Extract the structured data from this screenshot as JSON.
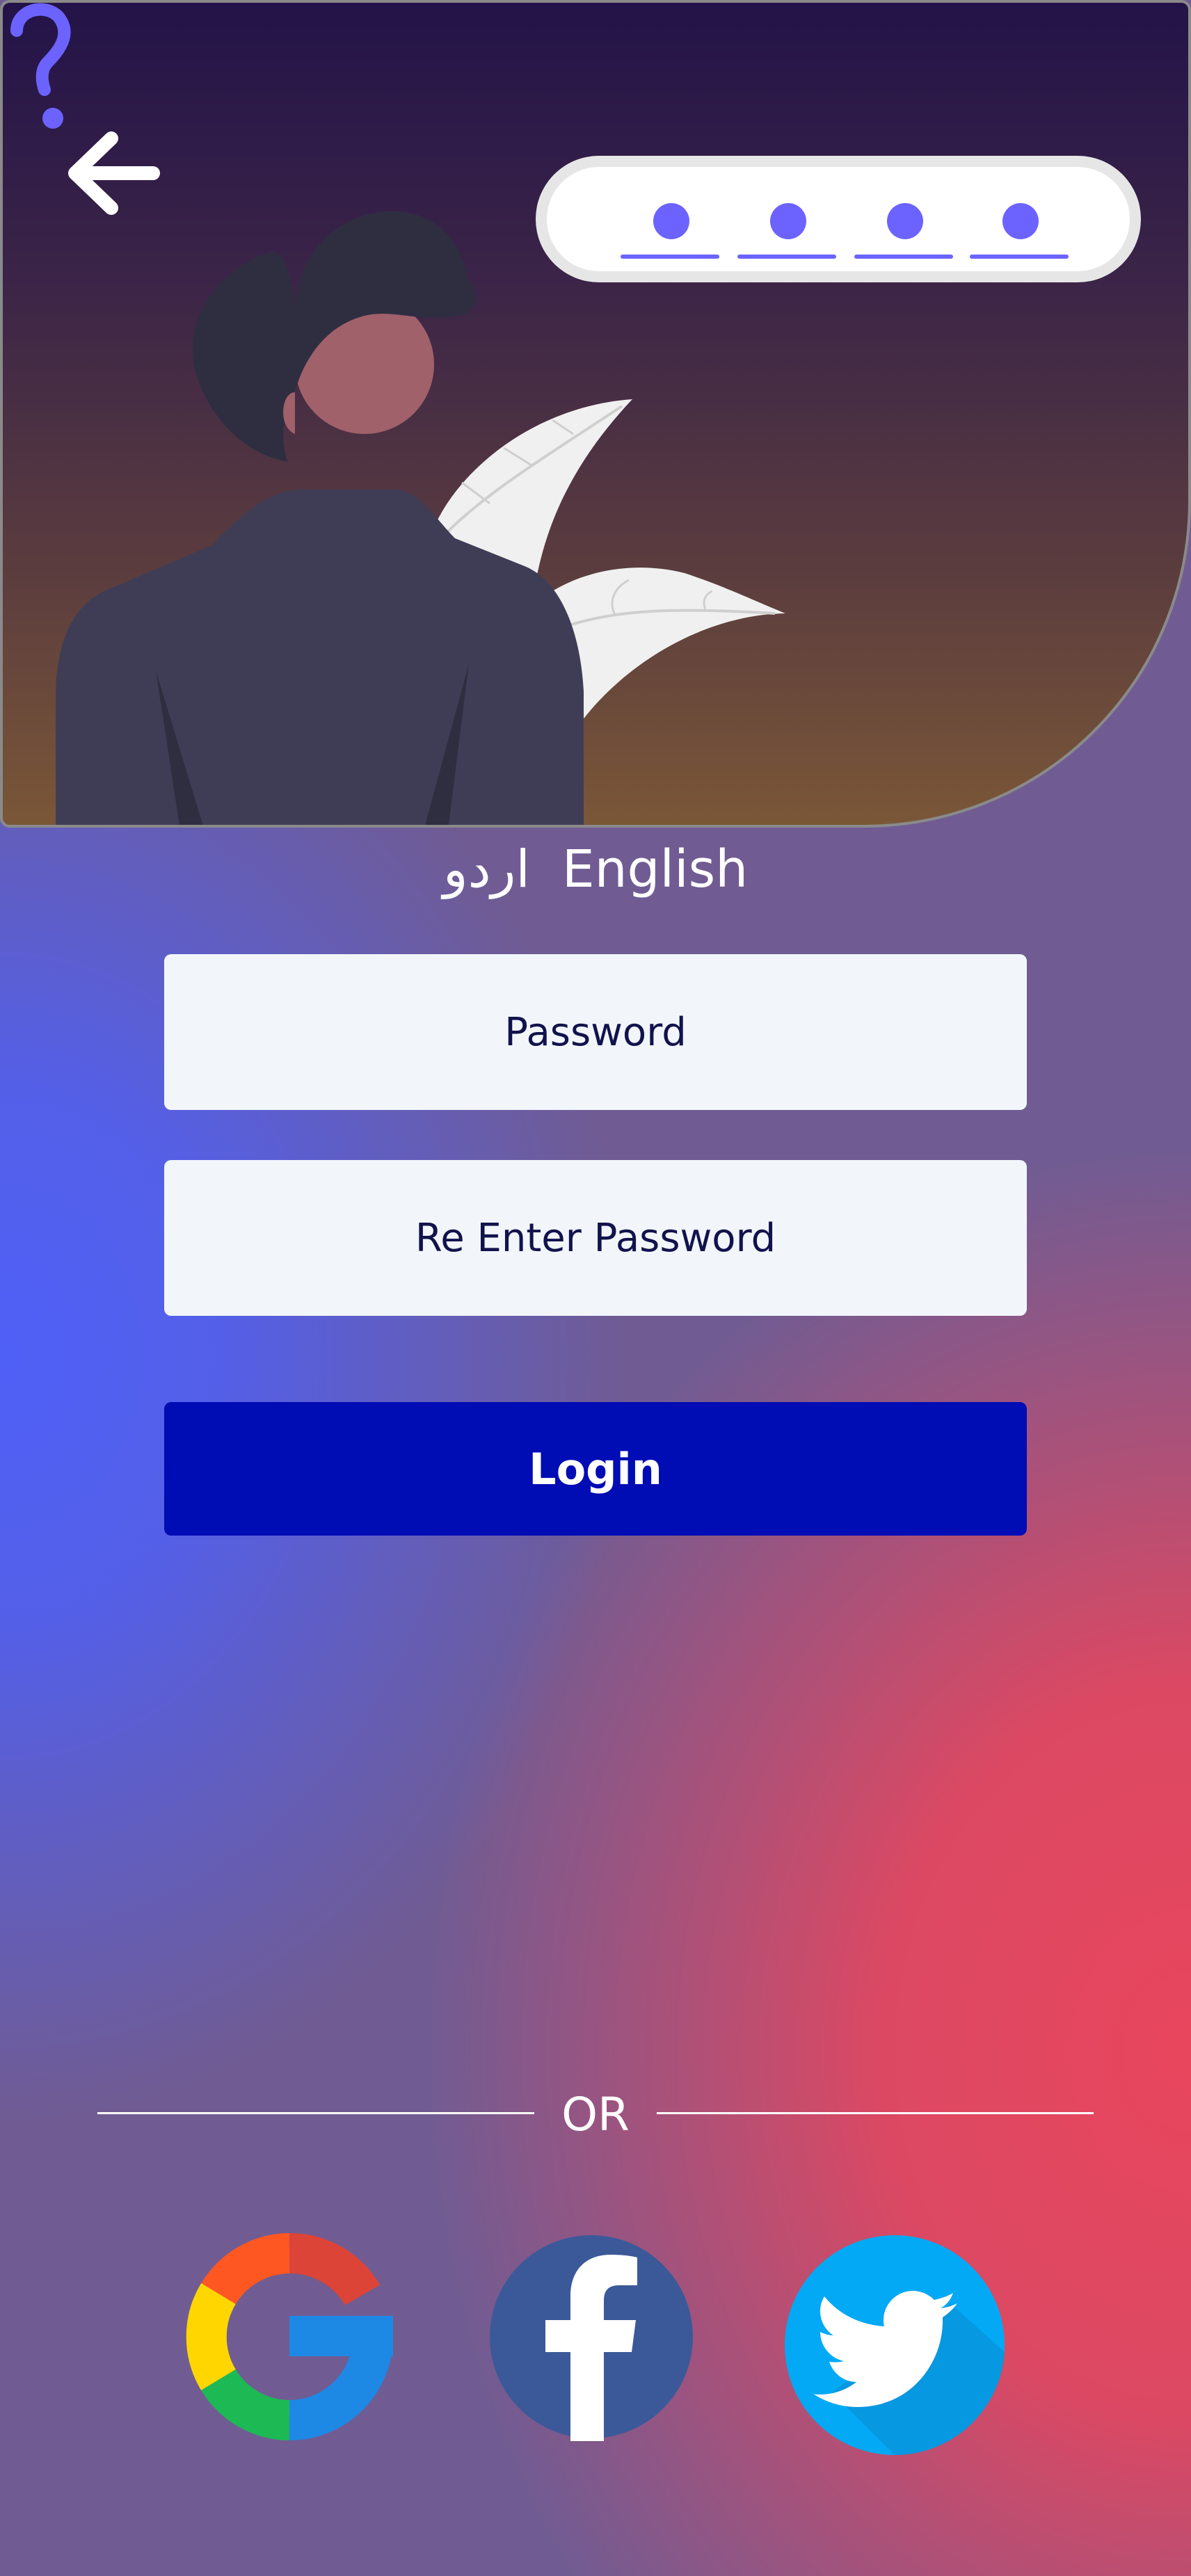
{
  "header": {
    "back_icon": "arrow-left-icon",
    "help_icon": "question-mark-icon",
    "pin_indicator": {
      "digits": 4,
      "filled": 4,
      "color": "#6c63ff"
    }
  },
  "language": {
    "options": [
      "اردو",
      "English"
    ]
  },
  "form": {
    "password_placeholder": "Password",
    "repassword_placeholder": "Re Enter Password",
    "login_label": "Login"
  },
  "divider": {
    "label": "OR"
  },
  "social": {
    "google_icon": "google-icon",
    "facebook_icon": "facebook-icon",
    "twitter_icon": "twitter-icon"
  },
  "colors": {
    "accent": "#6c63ff",
    "login_button": "#000cb4",
    "field_bg": "#f2f6fa",
    "field_text": "#12124d"
  }
}
